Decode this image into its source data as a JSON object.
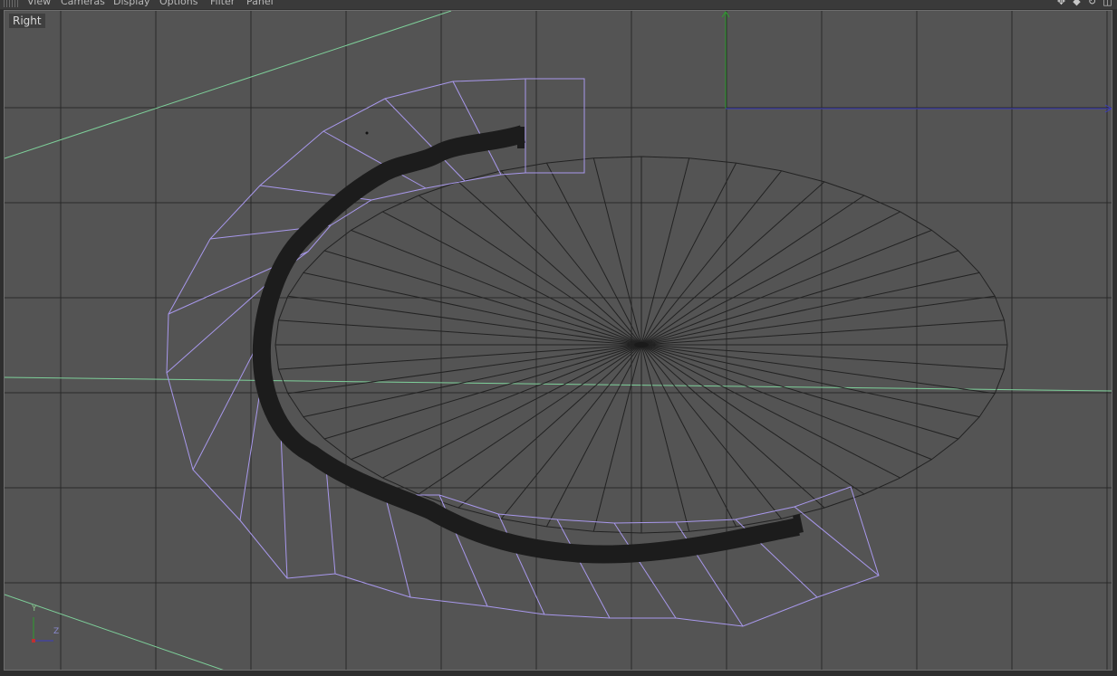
{
  "menubar": {
    "items": [
      "View",
      "Cameras",
      "Display",
      "Options",
      "Filter",
      "Panel"
    ],
    "nav_icons": [
      "move-view-icon",
      "scale-view-icon",
      "rotate-view-icon",
      "toggle-panel-icon"
    ]
  },
  "viewport": {
    "label": "Right",
    "axis": {
      "y": "Y",
      "z": "Z"
    }
  },
  "colors": {
    "viewport_bg": "#545454",
    "grid": "#2a2a2a",
    "guide_line": "#7ed09a",
    "cage_outline": "#a898ec",
    "spline_stroke": "#1c1c1c",
    "disk_wire": "#222222",
    "axis_y": "#2e9e2e",
    "axis_z": "#3d3dc0"
  }
}
